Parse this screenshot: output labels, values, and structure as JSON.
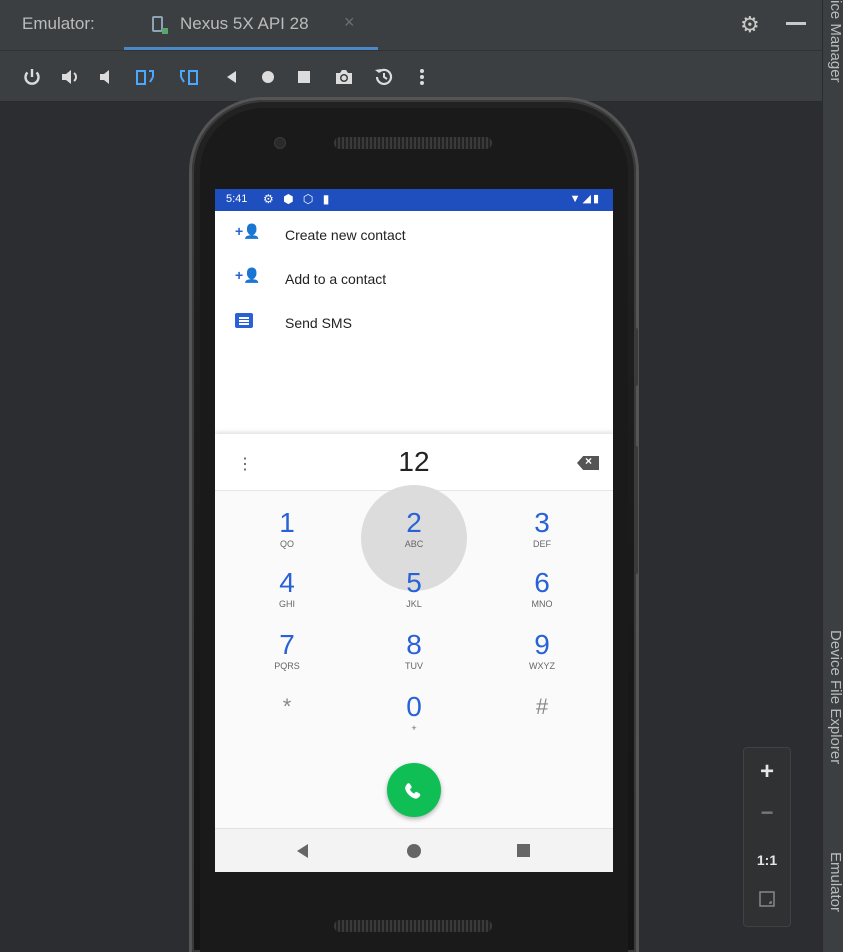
{
  "window": {
    "panel_label": "Emulator:",
    "tab_title": "Nexus 5X API 28",
    "tab_close": "×"
  },
  "toolbar": {
    "buttons": [
      "power",
      "volume-up",
      "volume-down",
      "rotate-left",
      "rotate-right",
      "back",
      "home",
      "overview",
      "screenshot",
      "snapshot",
      "more"
    ]
  },
  "side_tabs": {
    "top": "ice Manager",
    "middle": "Device File Explorer",
    "bottom": "Emulator"
  },
  "zoom": {
    "zoom_in": "+",
    "zoom_out": "−",
    "actual_size": "1:1"
  },
  "phone": {
    "status": {
      "time": "5:41",
      "icons": "⚙ ⬢ ⬡ ▮",
      "right": "▼◢▮"
    },
    "actions": [
      {
        "label": "Create new contact",
        "icon": "add-contact-icon"
      },
      {
        "label": "Add to a contact",
        "icon": "add-contact-icon"
      },
      {
        "label": "Send SMS",
        "icon": "sms-icon"
      }
    ],
    "dialpad": {
      "number": "12",
      "overflow": "⋮",
      "keys": [
        {
          "digit": "1",
          "letters": "QO"
        },
        {
          "digit": "2",
          "letters": "ABC"
        },
        {
          "digit": "3",
          "letters": "DEF"
        },
        {
          "digit": "4",
          "letters": "GHI"
        },
        {
          "digit": "5",
          "letters": "JKL"
        },
        {
          "digit": "6",
          "letters": "MNO"
        },
        {
          "digit": "7",
          "letters": "PQRS"
        },
        {
          "digit": "8",
          "letters": "TUV"
        },
        {
          "digit": "9",
          "letters": "WXYZ"
        },
        {
          "digit": "*",
          "letters": ""
        },
        {
          "digit": "0",
          "letters": "+"
        },
        {
          "digit": "#",
          "letters": ""
        }
      ]
    }
  },
  "colors": {
    "accent": "#2962d6",
    "status_bar": "#1f4fbf",
    "call_button": "#0fbe55",
    "ide_bg": "#2b2d30"
  }
}
